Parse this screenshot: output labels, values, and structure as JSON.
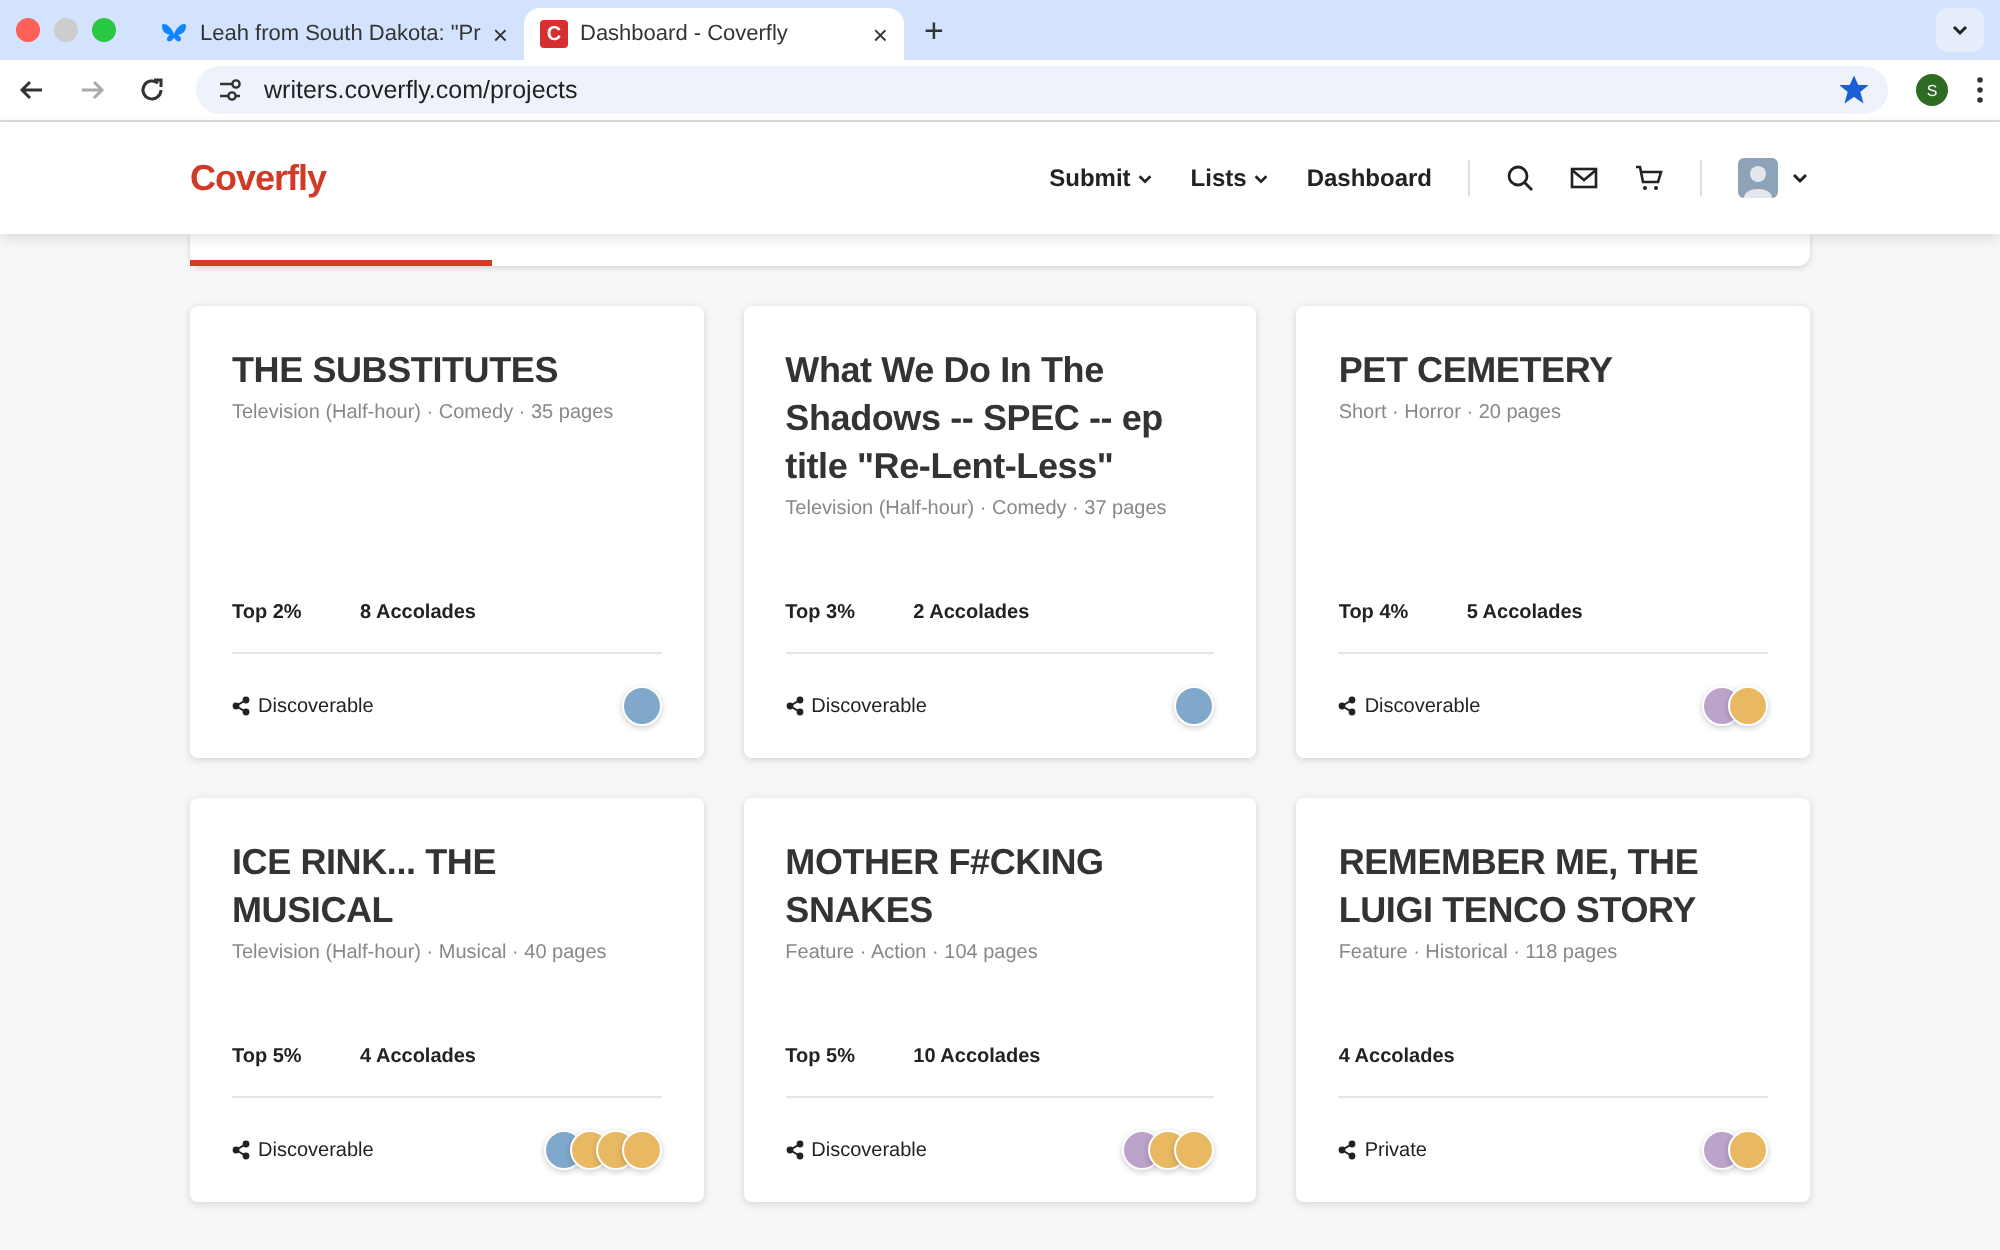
{
  "browser": {
    "tabs": [
      {
        "title": "Leah from South Dakota: \"Pr",
        "kind": "butterfly",
        "close": "×",
        "selected": false
      },
      {
        "title": "Dashboard - Coverfly",
        "kind": "letter",
        "icon_text": "C",
        "close": "×",
        "selected": true
      }
    ],
    "new_tab": "+",
    "url": "writers.coverfly.com/projects",
    "bookmarked": true,
    "profile_initial": "S"
  },
  "site": {
    "logo": "Coverfly",
    "nav": [
      {
        "label": "Submit",
        "dropdown": true
      },
      {
        "label": "Lists",
        "dropdown": true
      },
      {
        "label": "Dashboard",
        "dropdown": false
      }
    ]
  },
  "projects": [
    {
      "title": "THE SUBSTITUTES",
      "meta": "Television (Half-hour) · Comedy · 35 pages",
      "rank": "Top 2%",
      "accolades": "8 Accolades",
      "visibility": "Discoverable",
      "badges": [
        {
          "color": "#7fa8cb"
        }
      ]
    },
    {
      "title": "What We Do In The Shadows -- SPEC -- ep title \"Re-Lent-Less\"",
      "meta": "Television (Half-hour) · Comedy · 37 pages",
      "rank": "Top 3%",
      "accolades": "2 Accolades",
      "visibility": "Discoverable",
      "badges": [
        {
          "color": "#7fa8cb"
        }
      ]
    },
    {
      "title": "PET CEMETERY",
      "meta": "Short · Horror · 20 pages",
      "rank": "Top 4%",
      "accolades": "5 Accolades",
      "visibility": "Discoverable",
      "badges": [
        {
          "color": "#bba3c9"
        },
        {
          "color": "#e8b962"
        }
      ]
    },
    {
      "title": "ICE RINK... THE MUSICAL",
      "meta": "Television (Half-hour) · Musical · 40 pages",
      "rank": "Top 5%",
      "accolades": "4 Accolades",
      "visibility": "Discoverable",
      "badges": [
        {
          "color": "#7fa8cb"
        },
        {
          "color": "#e8b962"
        },
        {
          "color": "#e8b962"
        },
        {
          "color": "#e8b962"
        }
      ]
    },
    {
      "title": "MOTHER F#CKING SNAKES",
      "meta": "Feature · Action · 104 pages",
      "rank": "Top 5%",
      "accolades": "10 Accolades",
      "visibility": "Discoverable",
      "badges": [
        {
          "color": "#bba3c9"
        },
        {
          "color": "#e8b962"
        },
        {
          "color": "#e8b962"
        }
      ]
    },
    {
      "title": "REMEMBER ME, THE LUIGI TENCO STORY",
      "meta": "Feature · Historical · 118 pages",
      "accolades": "4 Accolades",
      "visibility": "Private",
      "badges": [
        {
          "color": "#bba3c9"
        },
        {
          "color": "#e8b962"
        }
      ]
    }
  ]
}
